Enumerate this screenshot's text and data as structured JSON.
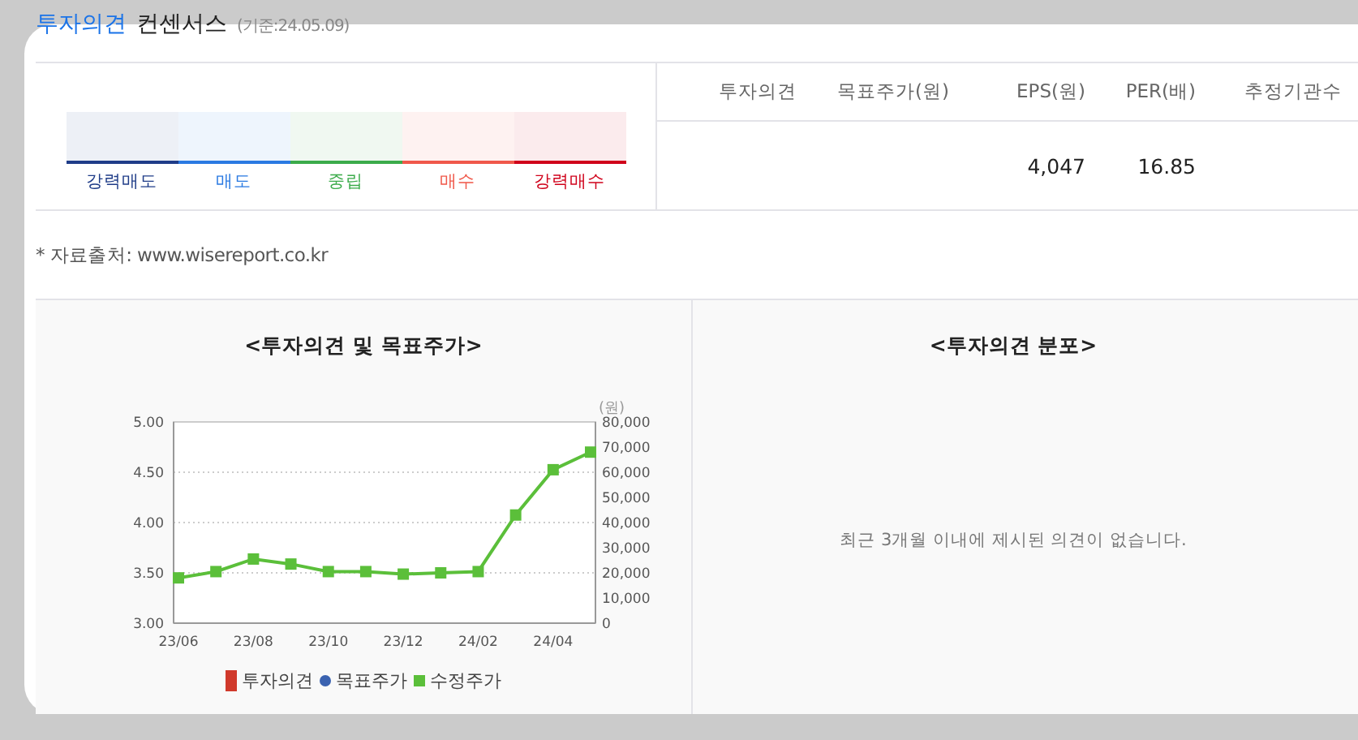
{
  "header": {
    "title_accent": "투자의견",
    "title": "컨센서스",
    "date": "(기준:24.05.09)"
  },
  "scale": [
    {
      "label": "강력매도",
      "color": "#1f3c88"
    },
    {
      "label": "매도",
      "color": "#2a7ae2"
    },
    {
      "label": "중립",
      "color": "#3bab4a"
    },
    {
      "label": "매수",
      "color": "#f0584a"
    },
    {
      "label": "강력매수",
      "color": "#d0021b"
    }
  ],
  "table": {
    "columns": [
      {
        "label": "투자의견"
      },
      {
        "label": "목표주가(원)"
      },
      {
        "label": "EPS(원)",
        "value": "4,047"
      },
      {
        "label": "PER(배)",
        "value": "16.85"
      },
      {
        "label": "추정기관수"
      }
    ]
  },
  "source": "* 자료출처: www.wisereport.co.kr",
  "left_panel": {
    "title": "<투자의견 및 목표주가>",
    "unit": "(원)",
    "opinion_axis": [
      "5.00",
      "4.50",
      "4.00",
      "3.50",
      "3.00"
    ],
    "legend": [
      {
        "label": "투자의견",
        "color": "#d0392b",
        "kind": "bar"
      },
      {
        "label": "목표주가",
        "color": "#3a62b0",
        "kind": "dot"
      }
    ],
    "chart_data": {
      "type": "line",
      "grid": true,
      "categories": [
        "23/06",
        null,
        "23/08",
        null,
        "23/10",
        null,
        "23/12",
        null,
        "24/02",
        null,
        "24/04",
        null
      ],
      "ylim": [
        0,
        80000
      ],
      "yticks": [
        {
          "value": 0,
          "label": "0"
        },
        {
          "value": 10000,
          "label": "10,000"
        },
        {
          "value": 20000,
          "label": "20,000"
        },
        {
          "value": 30000,
          "label": "30,000"
        },
        {
          "value": 40000,
          "label": "40,000"
        },
        {
          "value": 50000,
          "label": "50,000"
        },
        {
          "value": 60000,
          "label": "60,000"
        },
        {
          "value": 70000,
          "label": "70,000"
        },
        {
          "value": 80000,
          "label": "80,000"
        }
      ],
      "series": [
        {
          "name": "수정주가",
          "color": "#5bbf3a",
          "marker": "square",
          "values": [
            18000,
            20500,
            25500,
            23500,
            20500,
            20500,
            19500,
            20000,
            20500,
            43000,
            61000,
            68000
          ]
        }
      ]
    }
  },
  "right_panel": {
    "title": "<투자의견 분포>",
    "message": "최근 3개월 이내에 제시된 의견이 없습니다."
  }
}
